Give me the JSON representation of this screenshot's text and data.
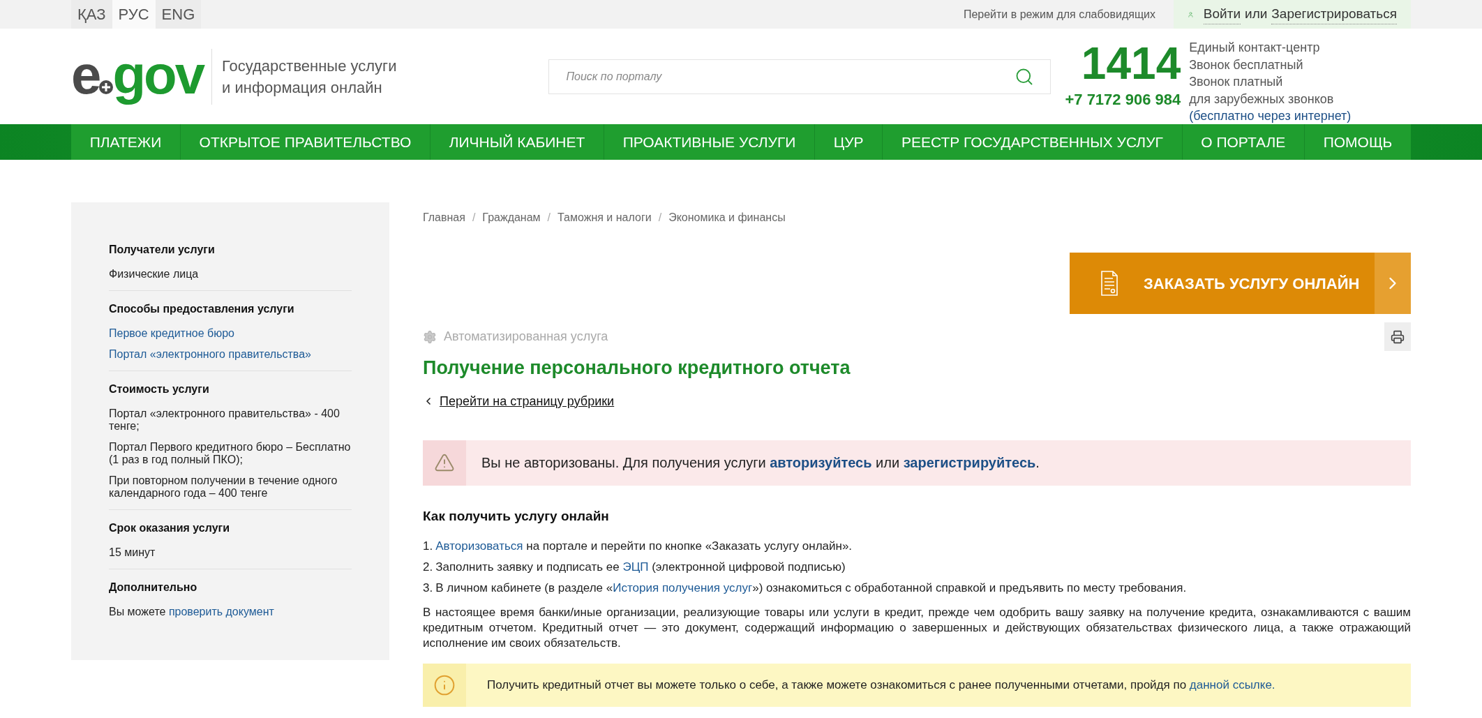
{
  "top_bar": {
    "languages": [
      {
        "label": "ҚАЗ",
        "selected": false
      },
      {
        "label": "РУС",
        "selected": true
      },
      {
        "label": "ENG",
        "selected": false
      }
    ],
    "accessibility_link": "Перейти в режим для слабовидящих",
    "login": {
      "sign_in": "Войти",
      "or": "или",
      "register": "Зарегистрироваться"
    }
  },
  "header": {
    "logo": {
      "left": "e",
      "right": "gov"
    },
    "tagline": [
      "Государственные услуги",
      "и информация онлайн"
    ],
    "search": {
      "placeholder": "Поиск по порталу"
    },
    "phone_short": "1414",
    "phone_long": "+7 7172 906 984",
    "contact_lines": [
      "Единый контакт-центр",
      "Звонок бесплатный",
      "Звонок платный",
      "для зарубежных звонков"
    ],
    "contact_link": "(бесплатно через интернет)"
  },
  "nav": [
    {
      "label": "ПЛАТЕЖИ"
    },
    {
      "label": "ОТКРЫТОЕ ПРАВИТЕЛЬСТВО"
    },
    {
      "label": "ЛИЧНЫЙ КАБИНЕТ"
    },
    {
      "label": "ПРОАКТИВНЫЕ УСЛУГИ"
    },
    {
      "label": "ЦУР"
    },
    {
      "label": "РЕЕСТР ГОСУДАРСТВЕННЫХ УСЛУГ"
    },
    {
      "label": "О ПОРТАЛЕ"
    },
    {
      "label": "ПОМОЩЬ"
    }
  ],
  "sidebar": {
    "sections": [
      {
        "title": "Получатели услуги",
        "items": [
          [
            {
              "kind": "text",
              "text": "Физические лица"
            }
          ]
        ]
      },
      {
        "title": "Способы предоставления услуги",
        "items": [
          [
            {
              "kind": "link",
              "text": "Первое кредитное бюро"
            }
          ],
          [
            {
              "kind": "link",
              "text": "Портал «электронного правительства»"
            }
          ]
        ]
      },
      {
        "title": "Стоимость услуги",
        "items": [
          [
            {
              "kind": "text",
              "text": "Портал «электронного правительства» - 400 тенге;"
            }
          ],
          [
            {
              "kind": "text",
              "text": "Портал Первого кредитного бюро – Бесплатно (1 раз в год полный ПКО);"
            }
          ],
          [
            {
              "kind": "text",
              "text": "При повторном получении в течение одного календарного года – 400 тенге"
            }
          ]
        ]
      },
      {
        "title": "Срок оказания услуги",
        "items": [
          [
            {
              "kind": "text",
              "text": "15 минут"
            }
          ]
        ]
      },
      {
        "title": "Дополнительно",
        "items": [
          [
            {
              "kind": "text",
              "text": "Вы можете "
            },
            {
              "kind": "link",
              "text": "проверить документ"
            }
          ]
        ]
      }
    ]
  },
  "breadcrumbs": [
    "Главная",
    "Гражданам",
    "Таможня и налоги",
    "Экономика и финансы"
  ],
  "breadcrumb_separator": "/",
  "order_button": "ЗАКАЗАТЬ УСЛУГУ ОНЛАЙН",
  "service_type": "Автоматизированная услуга",
  "title": "Получение персонального кредитного отчета",
  "back_link": "Перейти на страницу рубрики",
  "auth_alert": [
    {
      "kind": "text",
      "text": "Вы не авторизованы. Для получения услуги "
    },
    {
      "kind": "bold_link",
      "text": "авторизуйтесь"
    },
    {
      "kind": "text",
      "text": " или "
    },
    {
      "kind": "bold_link",
      "text": "зарегистрируйтесь"
    },
    {
      "kind": "text",
      "text": "."
    }
  ],
  "how_to": {
    "heading": "Как получить услугу онлайн",
    "steps": [
      {
        "number": "1.",
        "parts": [
          {
            "kind": "link",
            "text": "Авторизоваться"
          },
          {
            "kind": "text",
            "text": " на портале и перейти по кнопке «Заказать услугу онлайн»."
          }
        ]
      },
      {
        "number": "2.",
        "parts": [
          {
            "kind": "text",
            "text": "Заполнить заявку и подписать ее "
          },
          {
            "kind": "link",
            "text": "ЭЦП"
          },
          {
            "kind": "text",
            "text": " (электронной цифровой подписью)"
          }
        ]
      },
      {
        "number": "3.",
        "parts": [
          {
            "kind": "text",
            "text": "В личном кабинете (в разделе «"
          },
          {
            "kind": "link",
            "text": "История получения услуг"
          },
          {
            "kind": "text",
            "text": "») ознакомиться с обработанной справкой и предъявить по месту требования."
          }
        ]
      }
    ]
  },
  "description": "В настоящее время банки/иные организации, реализующие товары или услуги в кредит, прежде чем одобрить вашу заявку на получение кредита, ознакамливаются с вашим кредитным отчетом. Кредитный отчет — это документ, содержащий информацию о завершенных и действующих обязательствах физического лица, а также отражающий исполнение им своих обязательств.",
  "info_note": [
    {
      "kind": "text",
      "text": "Получить кредитный отчет вы можете только о себе, а также можете ознакомиться с ранее полученными отчетами, пройдя по "
    },
    {
      "kind": "link",
      "text": "данной ссылке."
    }
  ]
}
